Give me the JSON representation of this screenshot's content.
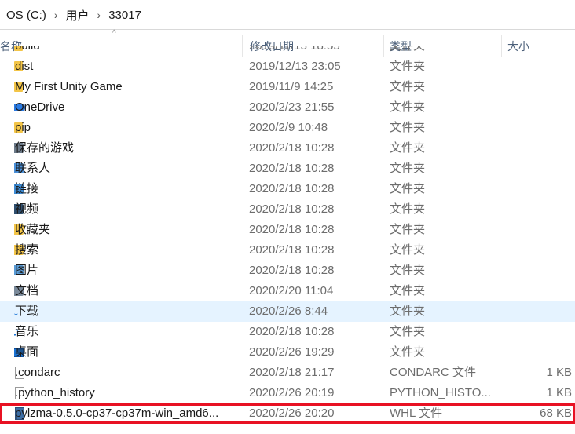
{
  "breadcrumb": [
    "OS (C:)",
    "用户",
    "33017"
  ],
  "columns": {
    "name": "名称",
    "date": "修改日期",
    "type": "类型",
    "size": "大小"
  },
  "files": [
    {
      "name": "build",
      "date": "2019/11/13 18:55",
      "type": "文件夹",
      "size": "",
      "icon": "folder-icon"
    },
    {
      "name": "dist",
      "date": "2019/12/13 23:05",
      "type": "文件夹",
      "size": "",
      "icon": "folder-icon"
    },
    {
      "name": "My First Unity Game",
      "date": "2019/11/9 14:25",
      "type": "文件夹",
      "size": "",
      "icon": "folder-icon"
    },
    {
      "name": "OneDrive",
      "date": "2020/2/23 21:55",
      "type": "文件夹",
      "size": "",
      "icon": "onedrive-icon"
    },
    {
      "name": "pip",
      "date": "2020/2/9 10:48",
      "type": "文件夹",
      "size": "",
      "icon": "folder-icon"
    },
    {
      "name": "保存的游戏",
      "date": "2020/2/18 10:28",
      "type": "文件夹",
      "size": "",
      "icon": "saved-games-icon"
    },
    {
      "name": "联系人",
      "date": "2020/2/18 10:28",
      "type": "文件夹",
      "size": "",
      "icon": "contacts-icon"
    },
    {
      "name": "链接",
      "date": "2020/2/18 10:28",
      "type": "文件夹",
      "size": "",
      "icon": "links-icon"
    },
    {
      "name": "视频",
      "date": "2020/2/18 10:28",
      "type": "文件夹",
      "size": "",
      "icon": "videos-icon"
    },
    {
      "name": "收藏夹",
      "date": "2020/2/18 10:28",
      "type": "文件夹",
      "size": "",
      "icon": "favorites-icon"
    },
    {
      "name": "搜索",
      "date": "2020/2/18 10:28",
      "type": "文件夹",
      "size": "",
      "icon": "searches-icon"
    },
    {
      "name": "图片",
      "date": "2020/2/18 10:28",
      "type": "文件夹",
      "size": "",
      "icon": "pictures-icon"
    },
    {
      "name": "文档",
      "date": "2020/2/20 11:04",
      "type": "文件夹",
      "size": "",
      "icon": "documents-icon"
    },
    {
      "name": "下载",
      "date": "2020/2/26 8:44",
      "type": "文件夹",
      "size": "",
      "icon": "downloads-icon"
    },
    {
      "name": "音乐",
      "date": "2020/2/18 10:28",
      "type": "文件夹",
      "size": "",
      "icon": "music-icon"
    },
    {
      "name": "桌面",
      "date": "2020/2/26 19:29",
      "type": "文件夹",
      "size": "",
      "icon": "desktop-icon"
    },
    {
      "name": ".condarc",
      "date": "2020/2/18 21:17",
      "type": "CONDARC 文件",
      "size": "1 KB",
      "icon": "file-icon"
    },
    {
      "name": ".python_history",
      "date": "2020/2/26 20:19",
      "type": "PYTHON_HISTO...",
      "size": "1 KB",
      "icon": "file-icon"
    },
    {
      "name": "pylzma-0.5.0-cp37-cp37m-win_amd6...",
      "date": "2020/2/26 20:20",
      "type": "WHL 文件",
      "size": "68 KB",
      "icon": "whl-file-icon"
    }
  ],
  "hovered_row": "下载",
  "selected_row": "pylzma-0.5.0-cp37-cp37m-win_amd6...",
  "colors": {
    "folder": "#f3c548",
    "accent": "#1a74d6",
    "hover": "#e5f3ff",
    "selection_outline": "#e81123"
  }
}
